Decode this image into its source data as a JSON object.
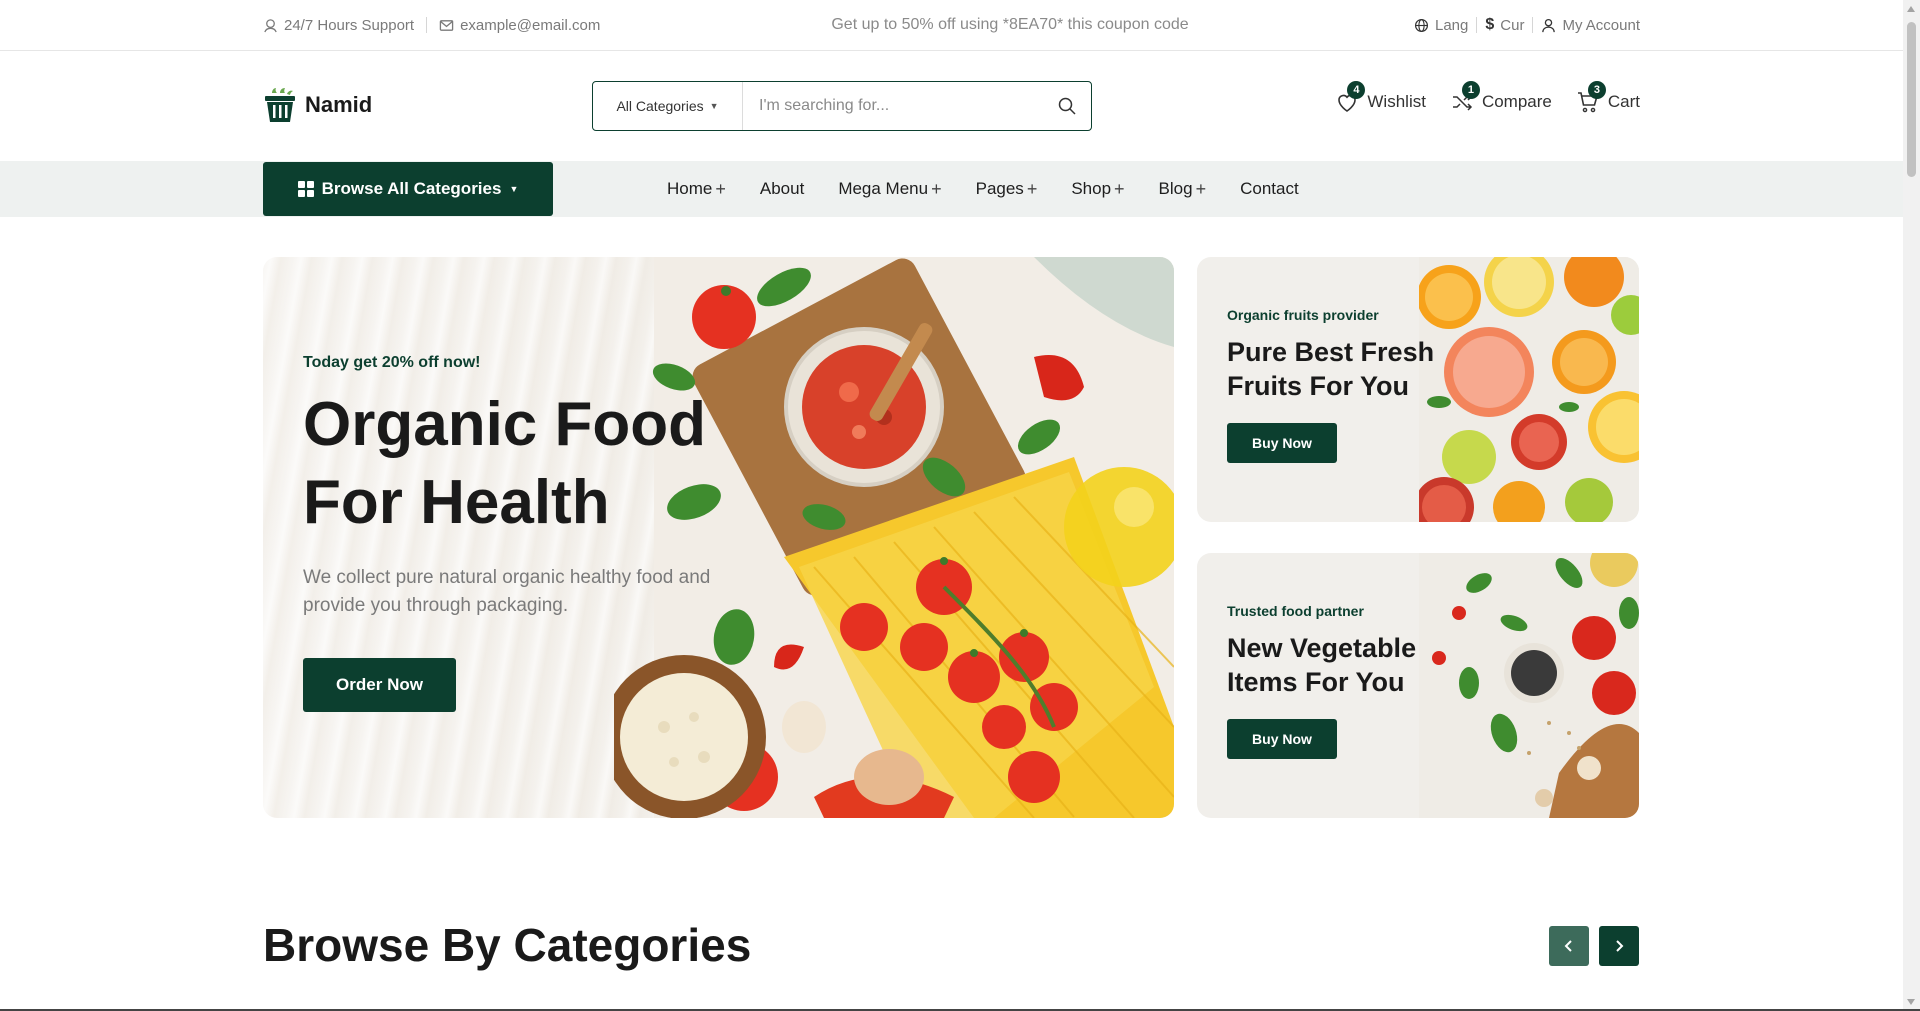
{
  "topbar": {
    "support": "24/7 Hours Support",
    "email": "example@email.com",
    "promo": "Get up to 50% off using *8EA70* this coupon code",
    "lang": "Lang",
    "cur": "Cur",
    "account": "My Account"
  },
  "header": {
    "logo": "Namid",
    "search": {
      "category": "All Categories",
      "placeholder": "I'm searching for..."
    },
    "wishlist": {
      "label": "Wishlist",
      "count": "4"
    },
    "compare": {
      "label": "Compare",
      "count": "1"
    },
    "cart": {
      "label": "Cart",
      "count": "3"
    }
  },
  "nav": {
    "browse": "Browse All Categories",
    "links": [
      {
        "label": "Home"
      },
      {
        "label": "About"
      },
      {
        "label": "Mega Menu"
      },
      {
        "label": "Pages"
      },
      {
        "label": "Shop"
      },
      {
        "label": "Blog"
      },
      {
        "label": "Contact"
      }
    ]
  },
  "hero": {
    "sub": "Today get 20% off now!",
    "title_line1": "Organic Food",
    "title_line2": "For Health",
    "text": "We collect pure natural organic healthy food and provide you through packaging.",
    "button": "Order Now"
  },
  "banners": [
    {
      "tag": "Organic fruits provider",
      "title": "Pure Best Fresh Fruits For You",
      "button": "Buy Now"
    },
    {
      "tag": "Trusted food partner",
      "title": "New Vegetable Items For You",
      "button": "Buy Now"
    }
  ],
  "categories": {
    "title": "Browse By Categories"
  },
  "colors": {
    "brand": "#0c3f2f",
    "muted": "#7a7a7a",
    "nav_bg": "#eef1f0"
  }
}
